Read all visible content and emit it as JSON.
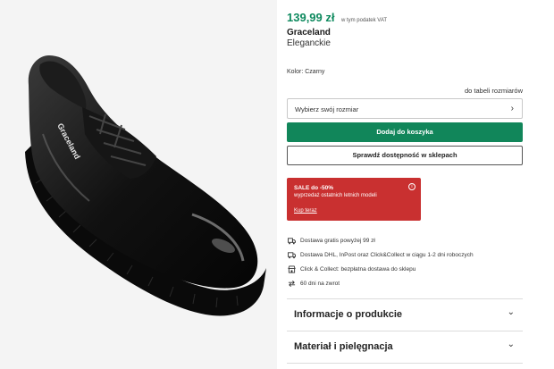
{
  "product": {
    "price": "139,99 zł",
    "vat_note": "w tym podatek VAT",
    "brand": "Graceland",
    "model": "Eleganckie",
    "color_label": "Kolor: Czarny",
    "shoe_logo": "Graceland"
  },
  "size": {
    "chart_link": "do tabeli rozmiarów",
    "select_label": "Wybierz swój rozmiar"
  },
  "buttons": {
    "add_to_cart": "Dodaj do koszyka",
    "check_availability": "Sprawdź dostępność w sklepach"
  },
  "sale_banner": {
    "title": "SALE do -50%",
    "subtitle": "wyprzedaż ostatnich letnich modeli",
    "link": "Kup teraz",
    "info_glyph": "i"
  },
  "features": [
    {
      "icon": "truck-icon",
      "text": "Dostawa gratis powyżej 99 zł"
    },
    {
      "icon": "delivery-van-icon",
      "text": "Dostawa DHL, InPost oraz Click&Collect w ciągu 1-2 dni roboczych"
    },
    {
      "icon": "store-icon",
      "text": "Click & Collect: bezpłatna dostawa do sklepu"
    },
    {
      "icon": "return-arrows-icon",
      "text": "60 dni na zwrot"
    }
  ],
  "accordions": [
    {
      "label": "Informacje o produkcie"
    },
    {
      "label": "Materiał i pielęgnacja"
    }
  ],
  "colors": {
    "price": "#0f8a5f",
    "add_button": "#11865a",
    "sale_banner": "#c93030"
  }
}
